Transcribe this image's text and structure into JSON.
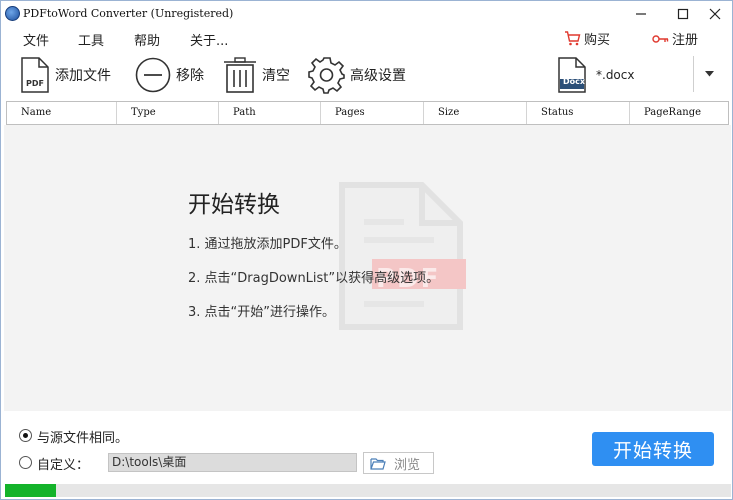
{
  "window": {
    "title": "PDFtoWord Converter (Unregistered)"
  },
  "menu": {
    "file": "文件",
    "tools": "工具",
    "help": "帮助",
    "about": "关于...",
    "buy": "购买",
    "register": "注册"
  },
  "toolbar": {
    "add_files": "添加文件",
    "remove": "移除",
    "clear": "清空",
    "advanced": "高级设置",
    "format_badge": "Docx",
    "format_value": "*.docx"
  },
  "table": {
    "columns": [
      "Name",
      "Type",
      "Path",
      "Pages",
      "Size",
      "Status",
      "PageRange"
    ]
  },
  "guide": {
    "title": "开始转换",
    "step1": "1. 通过拖放添加PDF文件。",
    "step2": "2. 点击“DragDownList”以获得高级选项。",
    "step3": "3. 点击“开始”进行操作。",
    "watermark_label": "PDF"
  },
  "output": {
    "same_as_source": "与源文件相同。",
    "custom": "自定义：",
    "path": "D:\\tools\\桌面",
    "browse": "浏览",
    "selected": "same_as_source"
  },
  "actions": {
    "start": "开始转换"
  },
  "progress": {
    "fraction": 0.07
  },
  "colors": {
    "accent": "#2f8ff2",
    "progress": "#14b32a",
    "danger_icon": "#e0392f"
  }
}
